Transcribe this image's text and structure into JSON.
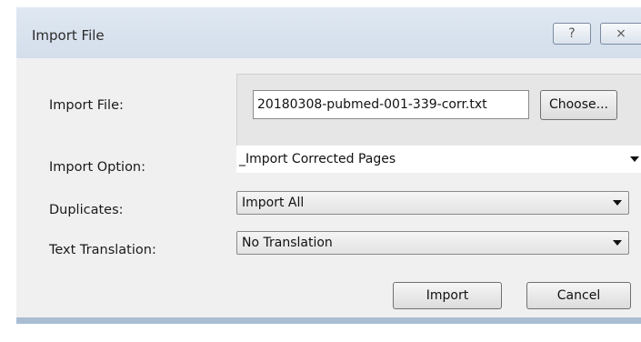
{
  "window": {
    "title": "Import File",
    "help_glyph": "?",
    "close_glyph": "⨯"
  },
  "form": {
    "import_file_label": "Import File:",
    "import_file_value": "20180308-pubmed-001-339-corr.txt",
    "choose_label": "Choose...",
    "import_option_label": "Import Option:",
    "import_option_value": "_Import Corrected Pages",
    "duplicates_label": "Duplicates:",
    "duplicates_value": "Import All",
    "text_translation_label": "Text Translation:",
    "text_translation_value": "No Translation"
  },
  "buttons": {
    "import_label": "Import",
    "cancel_label": "Cancel"
  },
  "colors": {
    "frame": "#a9bdd3",
    "client": "#f0f0f0"
  }
}
